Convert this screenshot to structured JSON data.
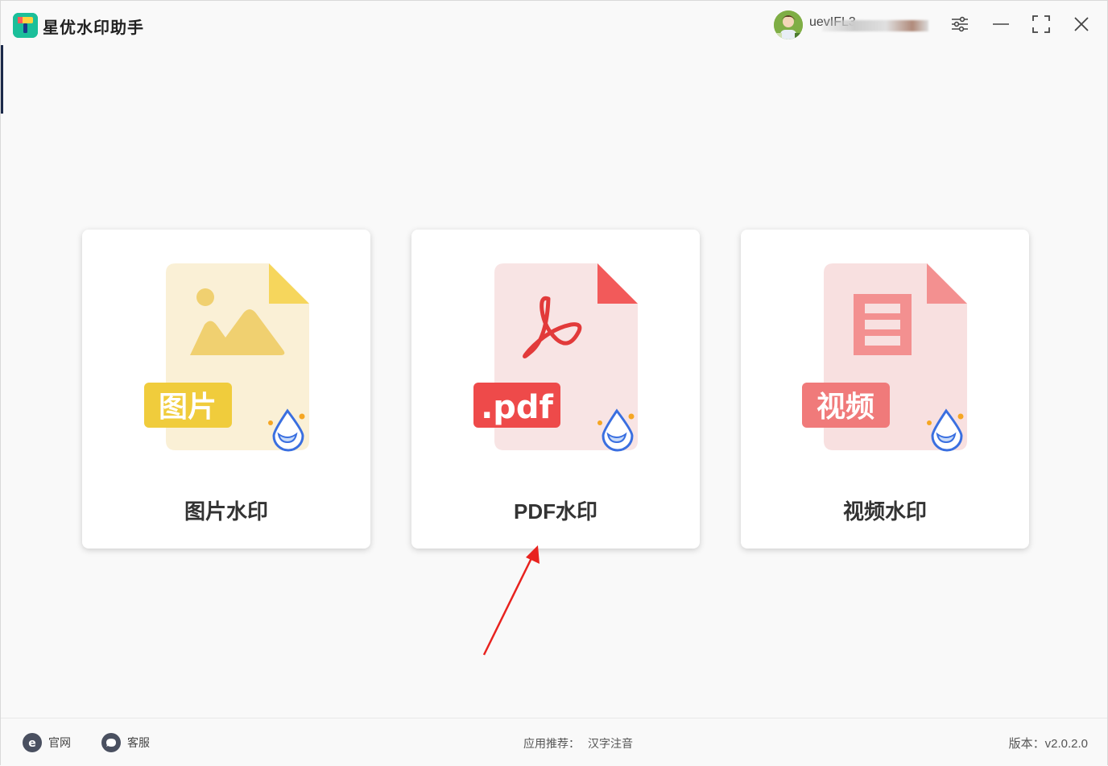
{
  "app": {
    "title": "星优水印助手",
    "username": "uevIFL3"
  },
  "cards": [
    {
      "label": "图片水印",
      "badge": "图片",
      "color": "#f0cc3c"
    },
    {
      "label": "PDF水印",
      "badge": ".pdf",
      "color": "#ee4a4a"
    },
    {
      "label": "视频水印",
      "badge": "视频",
      "color": "#f07a7a"
    }
  ],
  "footer": {
    "website_label": "官网",
    "support_label": "客服",
    "recommend_label": "应用推荐：",
    "recommend_link": "汉字注音",
    "version": "版本：v2.0.2.0"
  }
}
